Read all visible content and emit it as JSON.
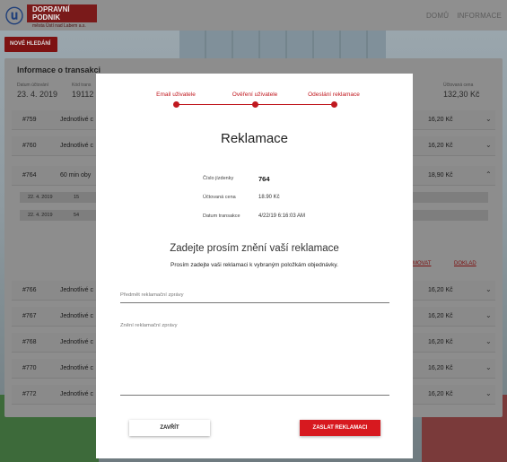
{
  "header": {
    "logo_line1": "DOPRAVNÍ PODNIK",
    "logo_line2": "města Ústí nad Labem a.s.",
    "nav": [
      "DOMŮ",
      "INFORMACE"
    ]
  },
  "new_search_label": "NOVÉ HLEDÁNÍ",
  "panel": {
    "title": "Informace o transakci",
    "summary": {
      "date_label": "Datum účtování",
      "date_value": "23. 4. 2019",
      "code_label": "Kód trans",
      "code_value": "19112",
      "total_label": "Účtovaná cena",
      "total_value": "132,30 Kč"
    },
    "rows": [
      {
        "id": "#759",
        "desc": "Jednotlivé c",
        "price": "16,20 Kč"
      },
      {
        "id": "#760",
        "desc": "Jednotlivé c",
        "price": "16,20 Kč"
      },
      {
        "id": "#764",
        "desc": "60 min oby",
        "price": "18,90 Kč"
      },
      {
        "id": "#766",
        "desc": "Jednotlivé c",
        "price": "16,20 Kč"
      },
      {
        "id": "#767",
        "desc": "Jednotlivé c",
        "price": "16,20 Kč"
      },
      {
        "id": "#768",
        "desc": "Jednotlivé c",
        "price": "16,20 Kč"
      },
      {
        "id": "#770",
        "desc": "Jednotlivé c",
        "price": "16,20 Kč"
      },
      {
        "id": "#772",
        "desc": "Jednotlivé c",
        "price": "16,20 Kč"
      }
    ],
    "subrows": [
      {
        "date": "22. 4. 2019",
        "num": "15"
      },
      {
        "date": "22. 4. 2019",
        "num": "54"
      }
    ],
    "link_a": "MOVAT",
    "link_b": "DOKLAD"
  },
  "modal": {
    "steps": [
      "Email uživatele",
      "Ověření uživatele",
      "Odeslání reklamace"
    ],
    "title": "Reklamace",
    "details": [
      {
        "label": "Číslo jízdenky",
        "value": "764"
      },
      {
        "label": "Účtovaná cena",
        "value": "18.90 Kč"
      },
      {
        "label": "Datum transakce",
        "value": "4/22/19 6:16:03 AM"
      }
    ],
    "subtitle": "Zadejte prosím znění vaší reklamace",
    "hint": "Prosím zadejte vaši reklamaci k vybraným položkám objednávky.",
    "subject_placeholder": "Předmět reklamační zprávy",
    "body_placeholder": "Znění reklamační zprávy",
    "close_label": "ZAVŘÍT",
    "send_label": "ZASLAT REKLAMACI"
  },
  "colors": {
    "accent": "#d7191f",
    "brand_dark": "#7a1a1a",
    "overlay": "#8d8d8d"
  }
}
